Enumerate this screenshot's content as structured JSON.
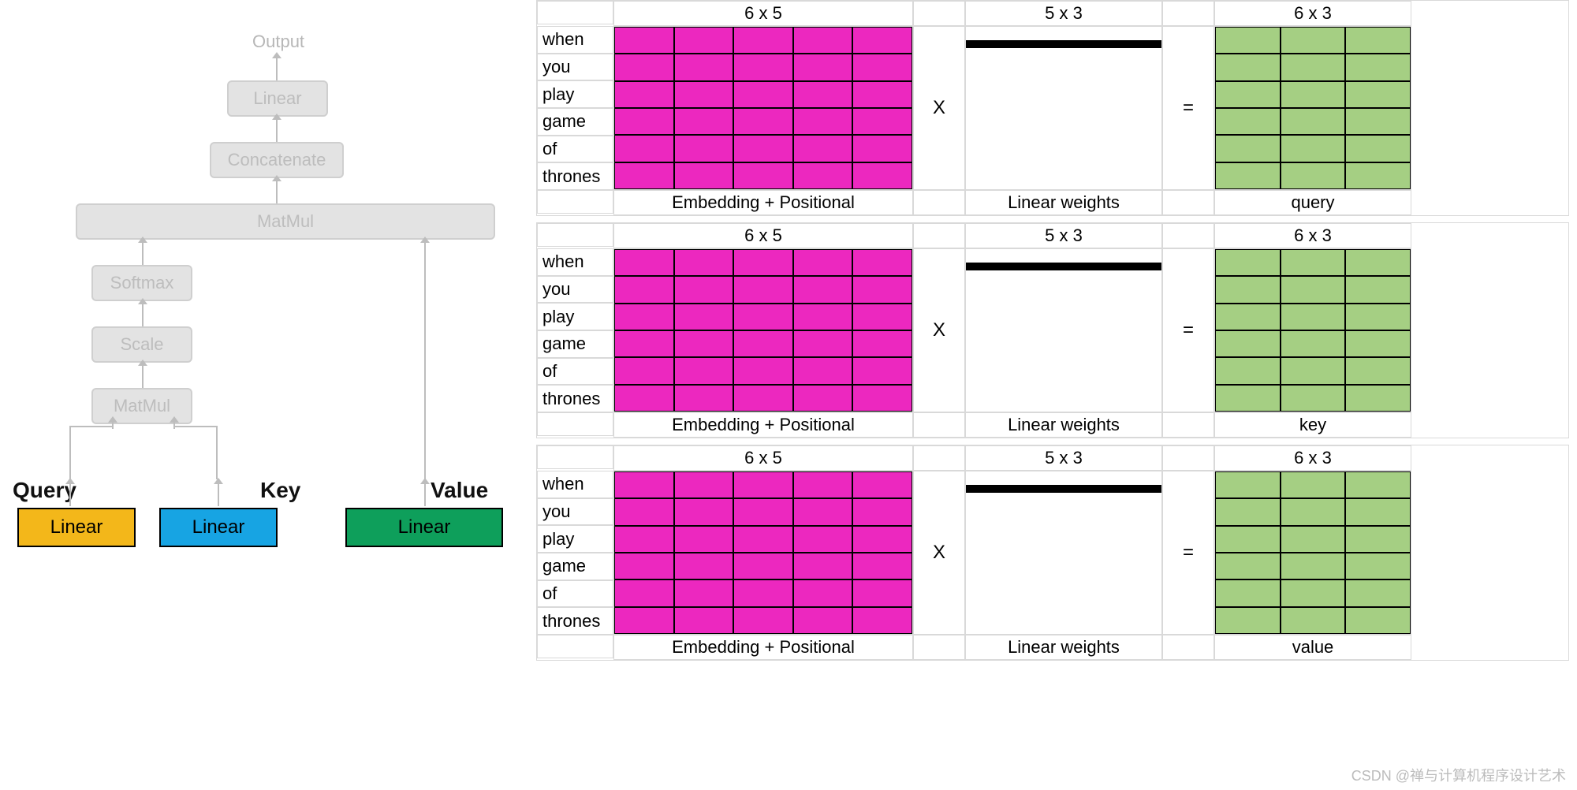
{
  "flow": {
    "output": "Output",
    "linear": "Linear",
    "concat": "Concatenate",
    "matmul_top": "MatMul",
    "softmax": "Softmax",
    "scale": "Scale",
    "matmul_bot": "MatMul",
    "q_label": "Query",
    "k_label": "Key",
    "v_label": "Value",
    "lin": "Linear"
  },
  "words": [
    "when",
    "you",
    "play",
    "game",
    "of",
    "thrones"
  ],
  "dims": {
    "emb": "6 x 5",
    "w": "5 x 3",
    "out": "6 x 3"
  },
  "ops": {
    "mul": "X",
    "eq": "="
  },
  "captions": {
    "emb": "Embedding + Positional",
    "w": "Linear weights"
  },
  "rows": [
    {
      "out_caption": "query",
      "w_color": "c-orange"
    },
    {
      "out_caption": "key",
      "w_color": "c-blue"
    },
    {
      "out_caption": "value",
      "w_color": "c-red"
    }
  ],
  "grids": {
    "emb_rows": 6,
    "emb_cols": 5,
    "w_rows": 5,
    "w_cols": 3,
    "out_rows": 6,
    "out_cols": 3
  },
  "watermark": "CSDN @禅与计算机程序设计艺术"
}
